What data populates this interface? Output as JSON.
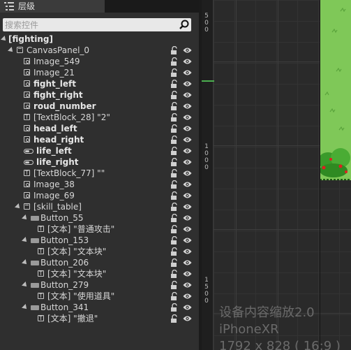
{
  "panel": {
    "tab_label": "层级",
    "search_placeholder": "搜索控件"
  },
  "tree": [
    {
      "label": "[fighting]",
      "icon": "none",
      "bold": true,
      "expanded": true
    },
    {
      "label": "CanvasPanel_0",
      "icon": "panel-icon",
      "bold": false,
      "expanded": true
    },
    {
      "label": "Image_549",
      "icon": "image-icon",
      "bold": false
    },
    {
      "label": "Image_21",
      "icon": "image-icon",
      "bold": false
    },
    {
      "label": "fight_left",
      "icon": "image-icon",
      "bold": true
    },
    {
      "label": "fight_right",
      "icon": "image-icon",
      "bold": true
    },
    {
      "label": "roud_number",
      "icon": "image-icon",
      "bold": true
    },
    {
      "label": "[TextBlock_28] \"2\"",
      "icon": "text-icon",
      "bold": false
    },
    {
      "label": "head_left",
      "icon": "image-icon",
      "bold": true
    },
    {
      "label": "head_right",
      "icon": "image-icon",
      "bold": true
    },
    {
      "label": "life_left",
      "icon": "progressbar-icon",
      "bold": true
    },
    {
      "label": "life_right",
      "icon": "progressbar-icon",
      "bold": true
    },
    {
      "label": "[TextBlock_77] \"\"",
      "icon": "text-icon",
      "bold": false
    },
    {
      "label": "Image_38",
      "icon": "image-icon",
      "bold": false
    },
    {
      "label": "Image_69",
      "icon": "image-icon",
      "bold": false
    },
    {
      "label": "[skill_table]",
      "icon": "panel-icon",
      "bold": false,
      "expanded": true
    },
    {
      "label": "Button_55",
      "icon": "button-icon",
      "bold": false,
      "expanded": true
    },
    {
      "label": "[文本] \"普通攻击\"",
      "icon": "text-icon",
      "bold": false
    },
    {
      "label": "Button_153",
      "icon": "button-icon",
      "bold": false,
      "expanded": true
    },
    {
      "label": "[文本] \"文本块\"",
      "icon": "text-icon",
      "bold": false
    },
    {
      "label": "Button_206",
      "icon": "button-icon",
      "bold": false,
      "expanded": true
    },
    {
      "label": "[文本] \"文本块\"",
      "icon": "text-icon",
      "bold": false
    },
    {
      "label": "Button_279",
      "icon": "button-icon",
      "bold": false,
      "expanded": true
    },
    {
      "label": "[文本] \"使用道具\"",
      "icon": "text-icon",
      "bold": false
    },
    {
      "label": "Button_341",
      "icon": "button-icon",
      "bold": false,
      "expanded": true
    },
    {
      "label": "[文本] \"撤退\"",
      "icon": "text-icon",
      "bold": false
    }
  ],
  "ruler": {
    "marks": [
      "5\n0\n0",
      "1\n0\n0\n0",
      "1\n5\n0\n0"
    ]
  },
  "designer": {
    "scale_text": "设备内容缩放2.0",
    "device_text": "iPhoneXR",
    "resolution_text": "1792 x 828 ( 16:9 )"
  },
  "colors": {
    "panel_bg": "#2f2f2f",
    "game_green": "#7fc858",
    "bush": "#3a9a2a"
  }
}
